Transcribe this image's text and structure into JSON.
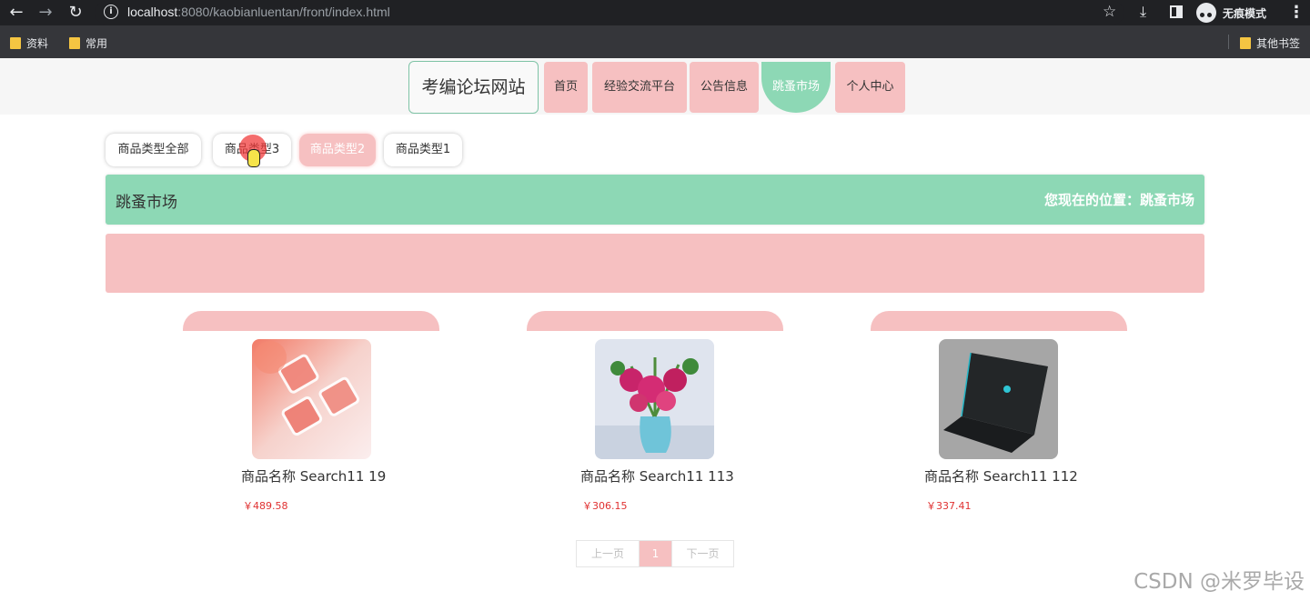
{
  "browser": {
    "url_host": "localhost",
    "url_rest": ":8080/kaobianluentan/front/index.html",
    "incognito_label": "无痕模式",
    "bookmarks": [
      "资料",
      "常用"
    ],
    "other_bookmarks": "其他书签"
  },
  "header": {
    "logo": "考编论坛网站",
    "nav": [
      "首页",
      "经验交流平台",
      "公告信息",
      "跳蚤市场",
      "个人中心"
    ],
    "active_nav": "跳蚤市场"
  },
  "categories": [
    "商品类型全部",
    "商品类型3",
    "商品类型2",
    "商品类型1"
  ],
  "active_category": "商品类型2",
  "title_bar": {
    "title": "跳蚤市场",
    "location": "您现在的位置：跳蚤市场"
  },
  "products": [
    {
      "name": "商品名称 Search11 19",
      "price": "￥489.58",
      "image": "pink-cosmetics-image"
    },
    {
      "name": "商品名称 Search11 113",
      "price": "￥306.15",
      "image": "lily-vase-image"
    },
    {
      "name": "商品名称 Search11 112",
      "price": "￥337.41",
      "image": "laptop-image"
    }
  ],
  "pagination": {
    "prev": "上一页",
    "current": "1",
    "next": "下一页"
  },
  "watermark": "CSDN @米罗毕设",
  "colors": {
    "accent_green": "#8dd8b5",
    "accent_pink": "#f6c0c1",
    "price_red": "#e03131"
  }
}
